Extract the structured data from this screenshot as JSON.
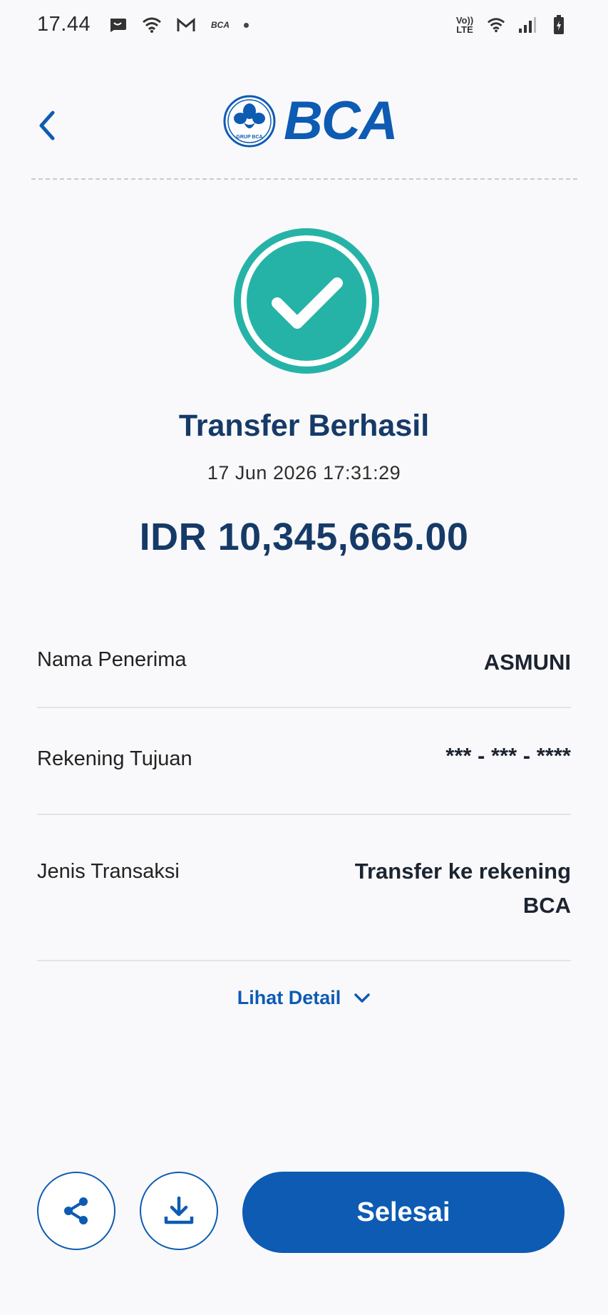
{
  "status_bar": {
    "time": "17.44",
    "left_icons": [
      "notification-app-icon",
      "wifi-icon",
      "gmail-icon",
      "bca-mobile-icon",
      "dot-icon"
    ],
    "bca_mobile_icon_text": "BCA",
    "volte_label_top": "Vo))",
    "volte_label_bottom": "LTE",
    "right_icons": [
      "volte-icon",
      "wifi-icon",
      "signal-icon",
      "battery-icon"
    ]
  },
  "header": {
    "logo_text": "BCA",
    "logo_emblem_text": "GRUP BCA"
  },
  "result": {
    "title": "Transfer Berhasil",
    "datetime": "17 Jun 2026 17:31:29",
    "amount": "IDR 10,345,665.00"
  },
  "details": [
    {
      "label": "Nama Penerima",
      "value": "ASMUNI"
    },
    {
      "label": "Rekening Tujuan",
      "value": "*** - *** - ****"
    },
    {
      "label": "Jenis Transaksi",
      "value_line1": "Transfer ke rekening",
      "value_line2": "BCA"
    }
  ],
  "detail_link": "Lihat Detail",
  "actions": {
    "done_label": "Selesai"
  },
  "colors": {
    "primary": "#0d5bb3",
    "success": "#26b3a7",
    "heading": "#163a68",
    "background": "#f9f9fb"
  }
}
